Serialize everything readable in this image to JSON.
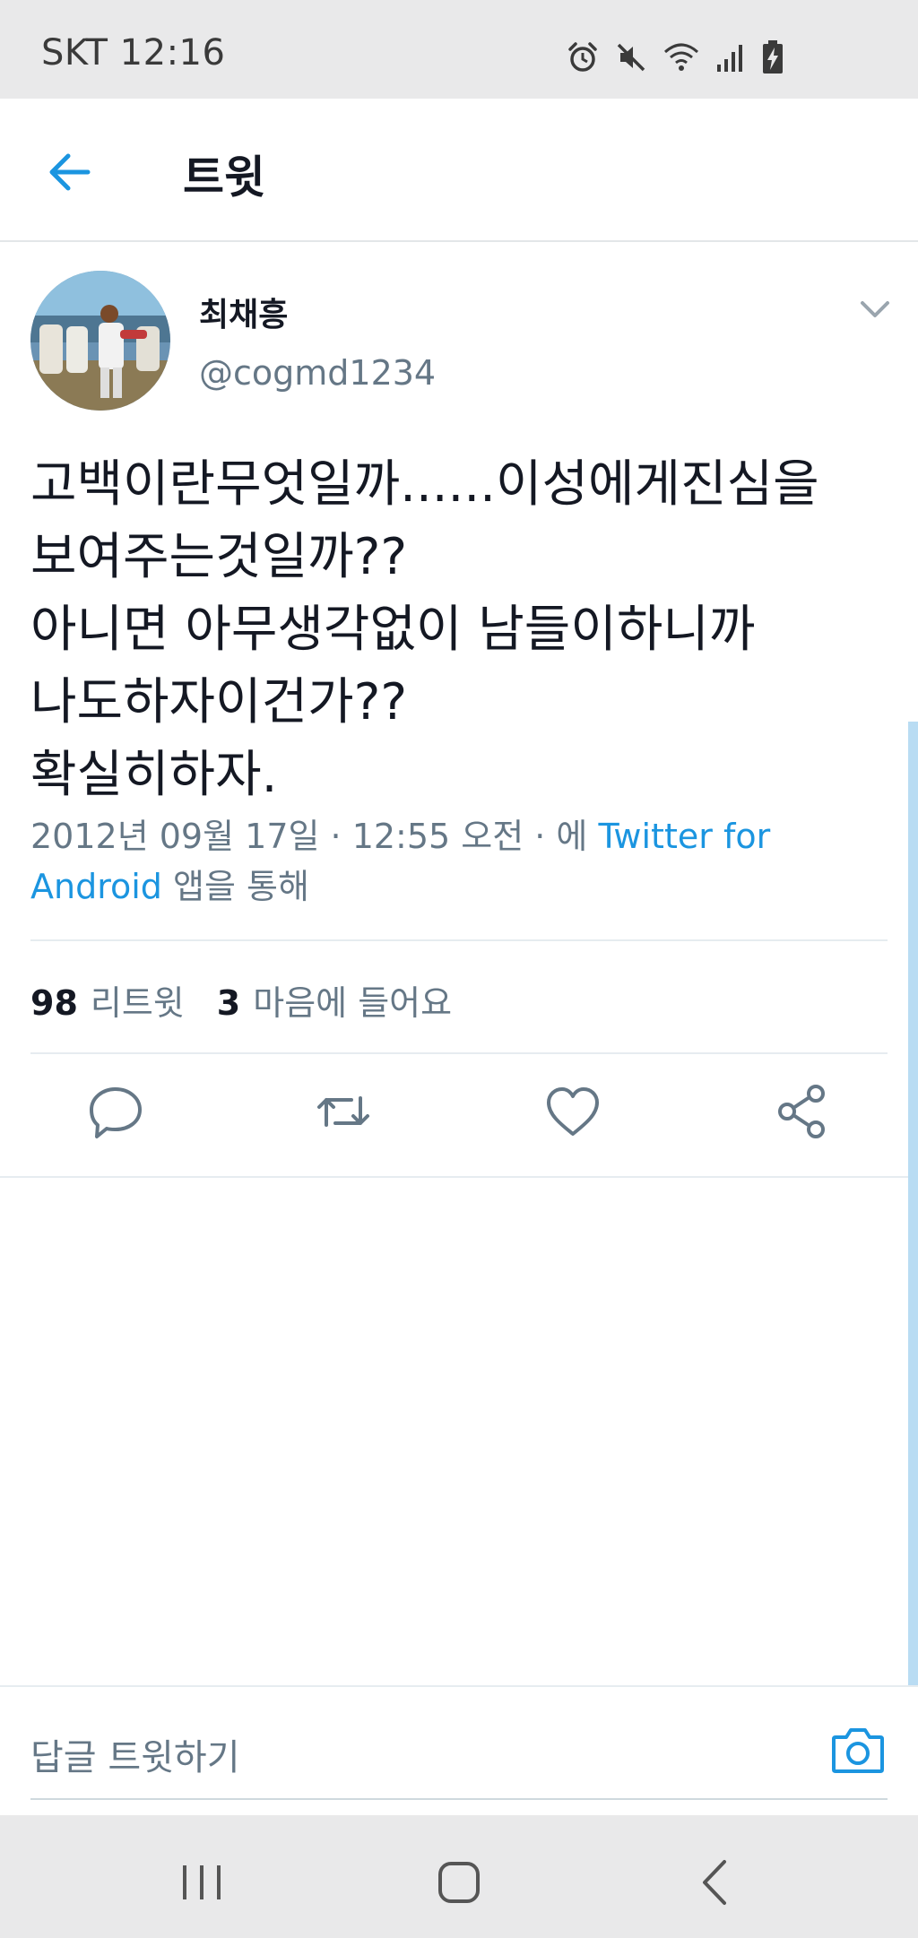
{
  "status_bar": {
    "carrier_time": "SKT 12:16",
    "icons": [
      "alarm-icon",
      "mute-icon",
      "wifi-icon",
      "signal-icon",
      "battery-charging-icon"
    ]
  },
  "app_bar": {
    "title": "트윗",
    "back_icon": "arrow-left-icon"
  },
  "tweet": {
    "display_name": "최채흥",
    "handle": "@cogmd1234",
    "text_lines": [
      "고백이란무엇일까......이성에게진심을",
      "보여주는것일까??",
      "아니면 아무생각없이 남들이하니까",
      "나도하자이건가??",
      "확실히하자."
    ],
    "timestamp": "2012년 09월 17일 · 12:55 오전 · 에",
    "source_link": "Twitter for Android",
    "source_suffix": "앱을 통해",
    "retweet_count": "98",
    "retweet_label": "리트윗",
    "like_count": "3",
    "like_label": "마음에 들어요"
  },
  "actions": [
    "reply-icon",
    "retweet-icon",
    "like-icon",
    "share-icon"
  ],
  "reply_bar": {
    "placeholder": "답글 트윗하기"
  },
  "nav_bar": [
    "recents-icon",
    "home-icon",
    "back-icon"
  ],
  "colors": {
    "accent": "#1b95e0",
    "secondary_text": "#657786",
    "primary_text": "#141823"
  }
}
